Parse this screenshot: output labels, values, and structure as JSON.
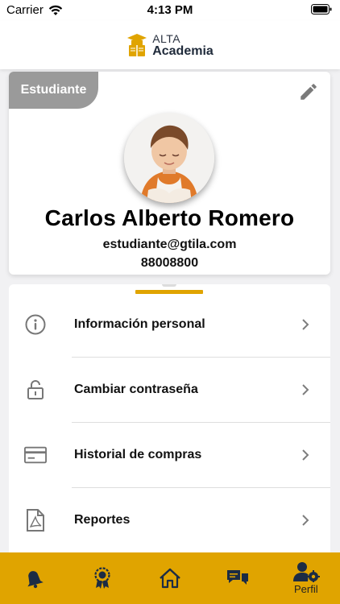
{
  "status_bar": {
    "carrier": "Carrier",
    "time": "4:13 PM"
  },
  "header": {
    "logo_line1": "ALTA",
    "logo_line2": "Academia"
  },
  "profile": {
    "role_badge": "Estudiante",
    "name": "Carlos Alberto Romero",
    "email": "estudiante@gtila.com",
    "phone": "88008800"
  },
  "menu": {
    "items": [
      {
        "label": "Información personal",
        "icon": "info-icon"
      },
      {
        "label": "Cambiar contraseña",
        "icon": "lock-icon"
      },
      {
        "label": "Historial de compras",
        "icon": "credit-card-icon"
      },
      {
        "label": "Reportes",
        "icon": "pdf-file-icon"
      }
    ]
  },
  "bottom_nav": {
    "items": [
      {
        "icon": "bell-icon",
        "label": ""
      },
      {
        "icon": "award-icon",
        "label": ""
      },
      {
        "icon": "home-icon",
        "label": ""
      },
      {
        "icon": "chat-icon",
        "label": ""
      },
      {
        "icon": "user-settings-icon",
        "label": "Perfil",
        "active": true
      }
    ]
  },
  "colors": {
    "accent": "#e0a400",
    "badge": "#9a9a9a",
    "text": "#111111"
  }
}
